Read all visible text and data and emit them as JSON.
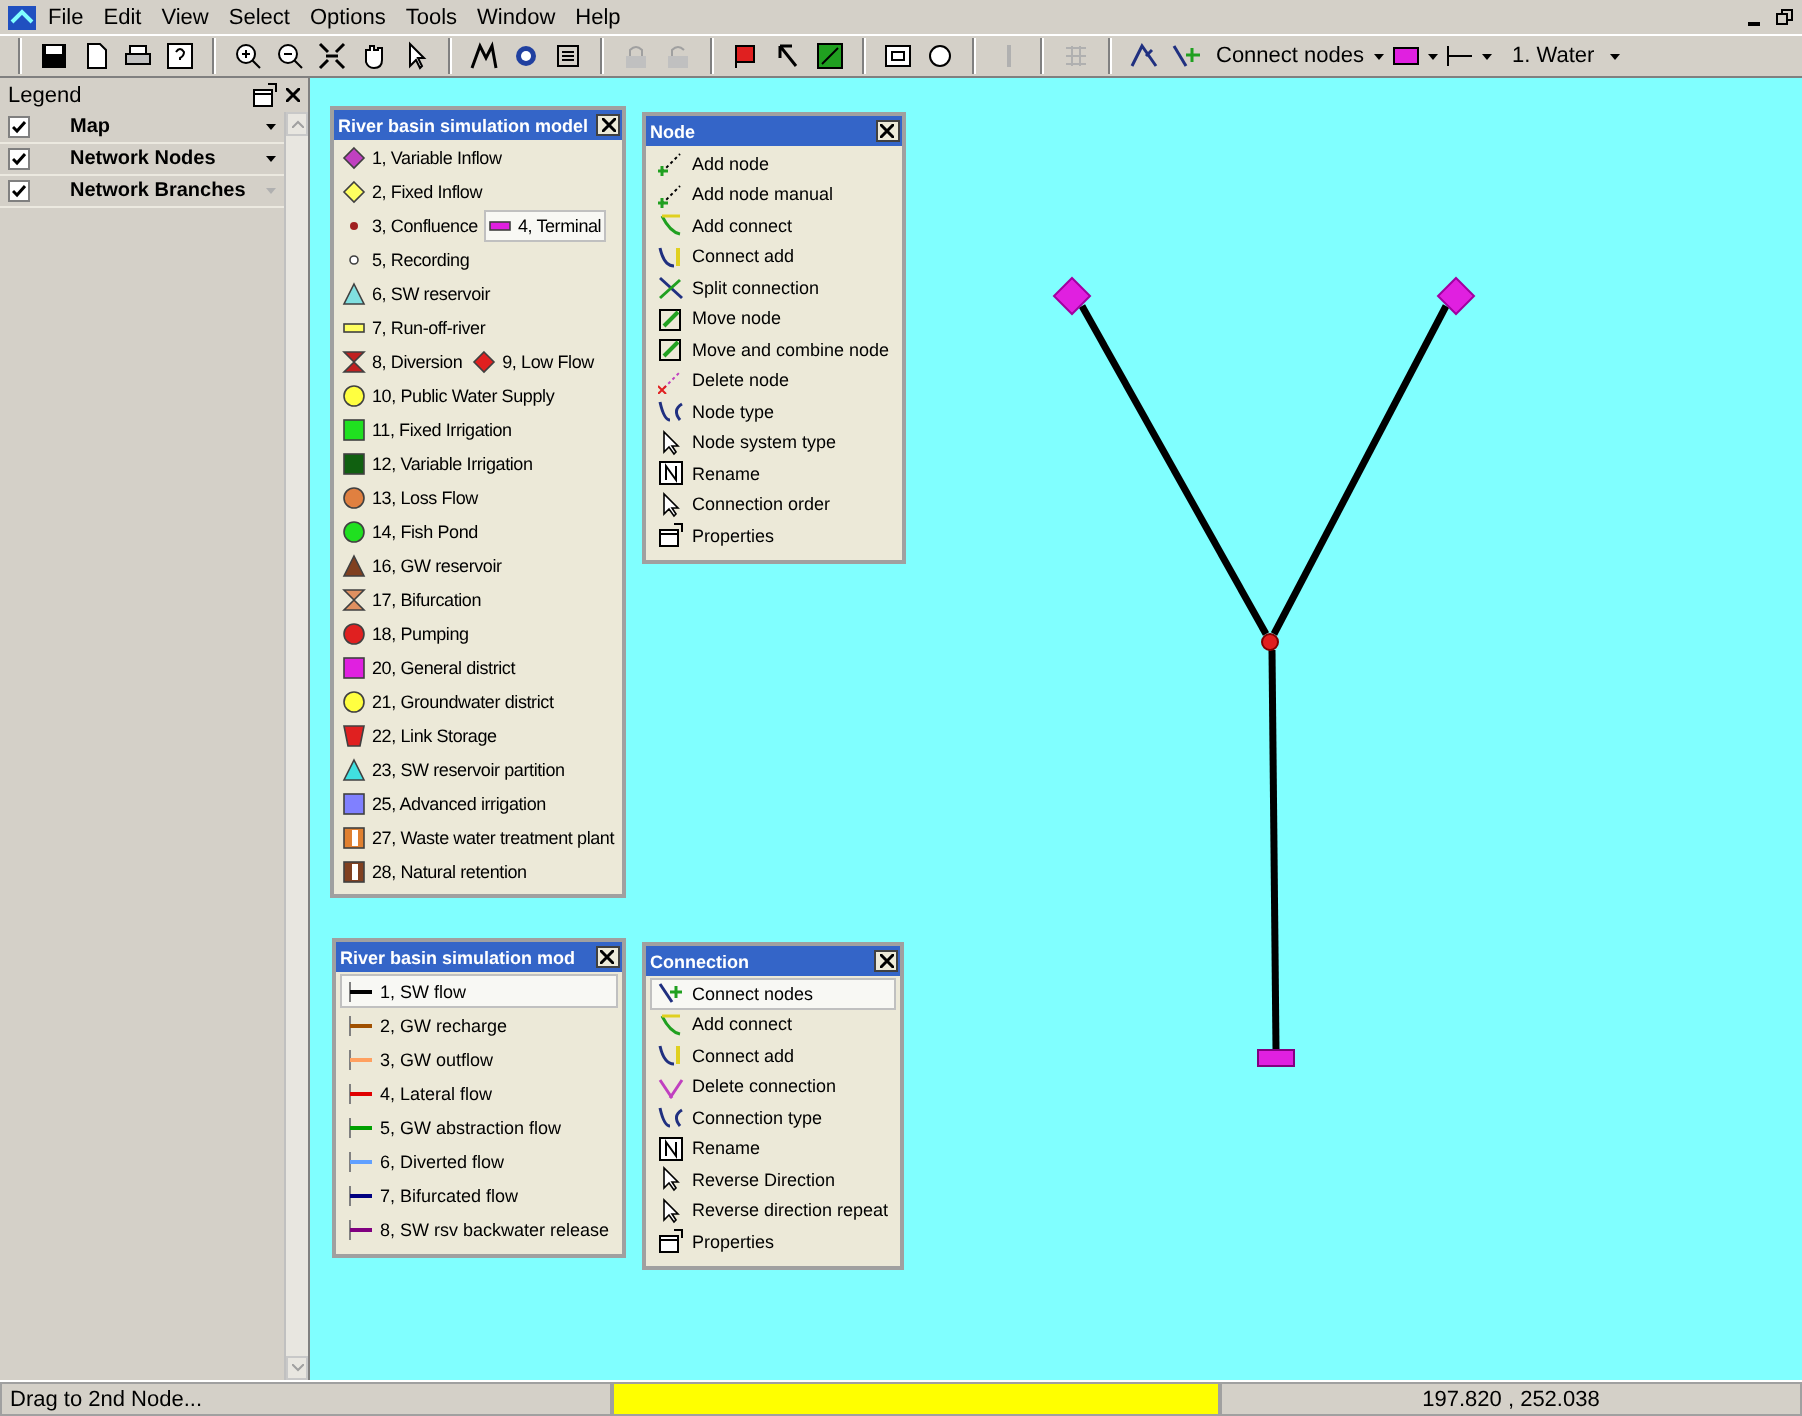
{
  "menu": [
    "File",
    "Edit",
    "View",
    "Select",
    "Options",
    "Tools",
    "Window",
    "Help"
  ],
  "toolbar": {
    "tool_label": "Connect nodes",
    "water_type": "1. Water"
  },
  "legend": {
    "title": "Legend",
    "layers": [
      {
        "label": "Map",
        "checked": true,
        "dropdown_enabled": true
      },
      {
        "label": "Network Nodes",
        "checked": true,
        "dropdown_enabled": true
      },
      {
        "label": "Network Branches",
        "checked": true,
        "dropdown_enabled": false
      }
    ]
  },
  "node_palette": {
    "title": "River basin simulation model",
    "rows": [
      [
        {
          "label": "1, Variable Inflow",
          "kind": "diamond",
          "color": "#c040c0",
          "selected": false
        }
      ],
      [
        {
          "label": "2, Fixed Inflow",
          "kind": "diamond",
          "color": "#ffff60",
          "selected": false
        }
      ],
      [
        {
          "label": "3, Confluence",
          "kind": "dot",
          "color": "#a02020",
          "selected": false
        },
        {
          "label": "4, Terminal",
          "kind": "bar",
          "color": "#e020e0",
          "selected": true
        }
      ],
      [
        {
          "label": "5, Recording",
          "kind": "ring",
          "color": "#ffffff",
          "selected": false
        }
      ],
      [
        {
          "label": "6, SW reservoir",
          "kind": "triangle",
          "color": "#80e0e0",
          "selected": false
        }
      ],
      [
        {
          "label": "7, Run-off-river",
          "kind": "bar",
          "color": "#ffff60",
          "selected": false
        }
      ],
      [
        {
          "label": "8, Diversion",
          "kind": "hourglass",
          "color": "#c02020",
          "selected": false
        },
        {
          "label": "9, Low Flow",
          "kind": "diamond",
          "color": "#e02020",
          "selected": false
        }
      ],
      [
        {
          "label": "10, Public Water Supply",
          "kind": "circle",
          "color": "#ffff40",
          "selected": false
        }
      ],
      [
        {
          "label": "11, Fixed Irrigation",
          "kind": "square",
          "color": "#20e020",
          "selected": false
        }
      ],
      [
        {
          "label": "12, Variable Irrigation",
          "kind": "square",
          "color": "#106010",
          "selected": false
        }
      ],
      [
        {
          "label": "13, Loss Flow",
          "kind": "circle",
          "color": "#e08040",
          "selected": false
        }
      ],
      [
        {
          "label": "14, Fish Pond",
          "kind": "circle",
          "color": "#20e020",
          "selected": false
        }
      ],
      [
        {
          "label": "16, GW reservoir",
          "kind": "triangle",
          "color": "#804020",
          "selected": false
        }
      ],
      [
        {
          "label": "17, Bifurcation",
          "kind": "hourglass",
          "color": "#e09060",
          "selected": false
        }
      ],
      [
        {
          "label": "18, Pumping",
          "kind": "circle",
          "color": "#e02020",
          "selected": false
        }
      ],
      [
        {
          "label": "20, General district",
          "kind": "square",
          "color": "#e020e0",
          "selected": false
        }
      ],
      [
        {
          "label": "21, Groundwater district",
          "kind": "circle",
          "color": "#ffff40",
          "selected": false
        }
      ],
      [
        {
          "label": "22, Link Storage",
          "kind": "trapezoid",
          "color": "#e02020",
          "selected": false
        }
      ],
      [
        {
          "label": "23, SW reservoir partition",
          "kind": "triangle",
          "color": "#40e0e0",
          "selected": false
        }
      ],
      [
        {
          "label": "25, Advanced irrigation",
          "kind": "square",
          "color": "#8080ff",
          "selected": false
        }
      ],
      [
        {
          "label": "27, Waste water treatment plant",
          "kind": "split",
          "color": "#e08030",
          "selected": false
        }
      ],
      [
        {
          "label": "28, Natural retention",
          "kind": "split",
          "color": "#804020",
          "selected": false
        }
      ]
    ]
  },
  "node_tools": {
    "title": "Node",
    "items": [
      {
        "label": "Add node",
        "kind": "add"
      },
      {
        "label": "Add node manual",
        "kind": "add"
      },
      {
        "label": "Add connect",
        "kind": "link"
      },
      {
        "label": "Connect add",
        "kind": "connect"
      },
      {
        "label": "Split connection",
        "kind": "split"
      },
      {
        "label": "Move node",
        "kind": "move"
      },
      {
        "label": "Move and combine node",
        "kind": "move"
      },
      {
        "label": "Delete node",
        "kind": "delete"
      },
      {
        "label": "Node type",
        "kind": "type"
      },
      {
        "label": "Node system type",
        "kind": "pointer"
      },
      {
        "label": "Rename",
        "kind": "rename"
      },
      {
        "label": "Connection order",
        "kind": "pointer"
      },
      {
        "label": "Properties",
        "kind": "properties"
      }
    ]
  },
  "branch_palette": {
    "title": "River basin simulation mod",
    "items": [
      {
        "label": "1, SW flow",
        "color": "#000000",
        "selected": true
      },
      {
        "label": "2, GW recharge",
        "color": "#a05000",
        "selected": false
      },
      {
        "label": "3, GW outflow",
        "color": "#ffa060",
        "selected": false
      },
      {
        "label": "4, Lateral flow",
        "color": "#e00000",
        "selected": false
      },
      {
        "label": "5, GW abstraction flow",
        "color": "#00a000",
        "selected": false
      },
      {
        "label": "6, Diverted flow",
        "color": "#60a0ff",
        "selected": false
      },
      {
        "label": "7, Bifurcated flow",
        "color": "#000080",
        "selected": false
      },
      {
        "label": "8, SW rsv backwater release",
        "color": "#800080",
        "selected": false
      }
    ]
  },
  "connection_tools": {
    "title": "Connection",
    "items": [
      {
        "label": "Connect nodes",
        "kind": "connect-nodes",
        "selected": true
      },
      {
        "label": "Add connect",
        "kind": "link",
        "selected": false
      },
      {
        "label": "Connect add",
        "kind": "connect",
        "selected": false
      },
      {
        "label": "Delete connection",
        "kind": "delete-line",
        "selected": false
      },
      {
        "label": "Connection type",
        "kind": "type",
        "selected": false
      },
      {
        "label": "Rename",
        "kind": "rename",
        "selected": false
      },
      {
        "label": "Reverse Direction",
        "kind": "pointer",
        "selected": false
      },
      {
        "label": "Reverse direction repeat",
        "kind": "pointer",
        "selected": false
      },
      {
        "label": "Properties",
        "kind": "properties",
        "selected": false
      }
    ]
  },
  "status_bar": {
    "message": "Drag to 2nd Node...",
    "coordinates": "197.820 , 252.038"
  }
}
